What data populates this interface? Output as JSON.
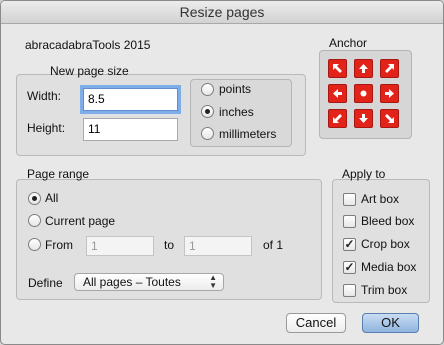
{
  "window": {
    "title": "Resize pages"
  },
  "app_name": "abracadabraTools 2015",
  "page_size": {
    "legend": "New page size",
    "width_label": "Width:",
    "width_value": "8.5",
    "height_label": "Height:",
    "height_value": "11",
    "units": [
      {
        "label": "points",
        "selected": false
      },
      {
        "label": "inches",
        "selected": true
      },
      {
        "label": "millimeters",
        "selected": false
      }
    ]
  },
  "anchor": {
    "legend": "Anchor",
    "buttons": [
      "arrow-up-left-icon",
      "arrow-up-icon",
      "arrow-up-right-icon",
      "arrow-left-icon",
      "dot-center-icon",
      "arrow-right-icon",
      "arrow-down-left-icon",
      "arrow-down-icon",
      "arrow-down-right-icon"
    ],
    "color": "#e2231a"
  },
  "page_range": {
    "legend": "Page range",
    "all_label": "All",
    "current_label": "Current page",
    "from_label": "From",
    "from_value": "1",
    "to_label": "to",
    "to_value": "1",
    "of_text": "of 1",
    "selected": "All",
    "define_label": "Define",
    "define_value": "All pages – Toutes"
  },
  "apply_to": {
    "legend": "Apply to",
    "boxes": [
      {
        "label": "Art box",
        "checked": false
      },
      {
        "label": "Bleed box",
        "checked": false
      },
      {
        "label": "Crop box",
        "checked": true
      },
      {
        "label": "Media box",
        "checked": true
      },
      {
        "label": "Trim box",
        "checked": false
      }
    ]
  },
  "buttons": {
    "cancel": "Cancel",
    "ok": "OK"
  }
}
